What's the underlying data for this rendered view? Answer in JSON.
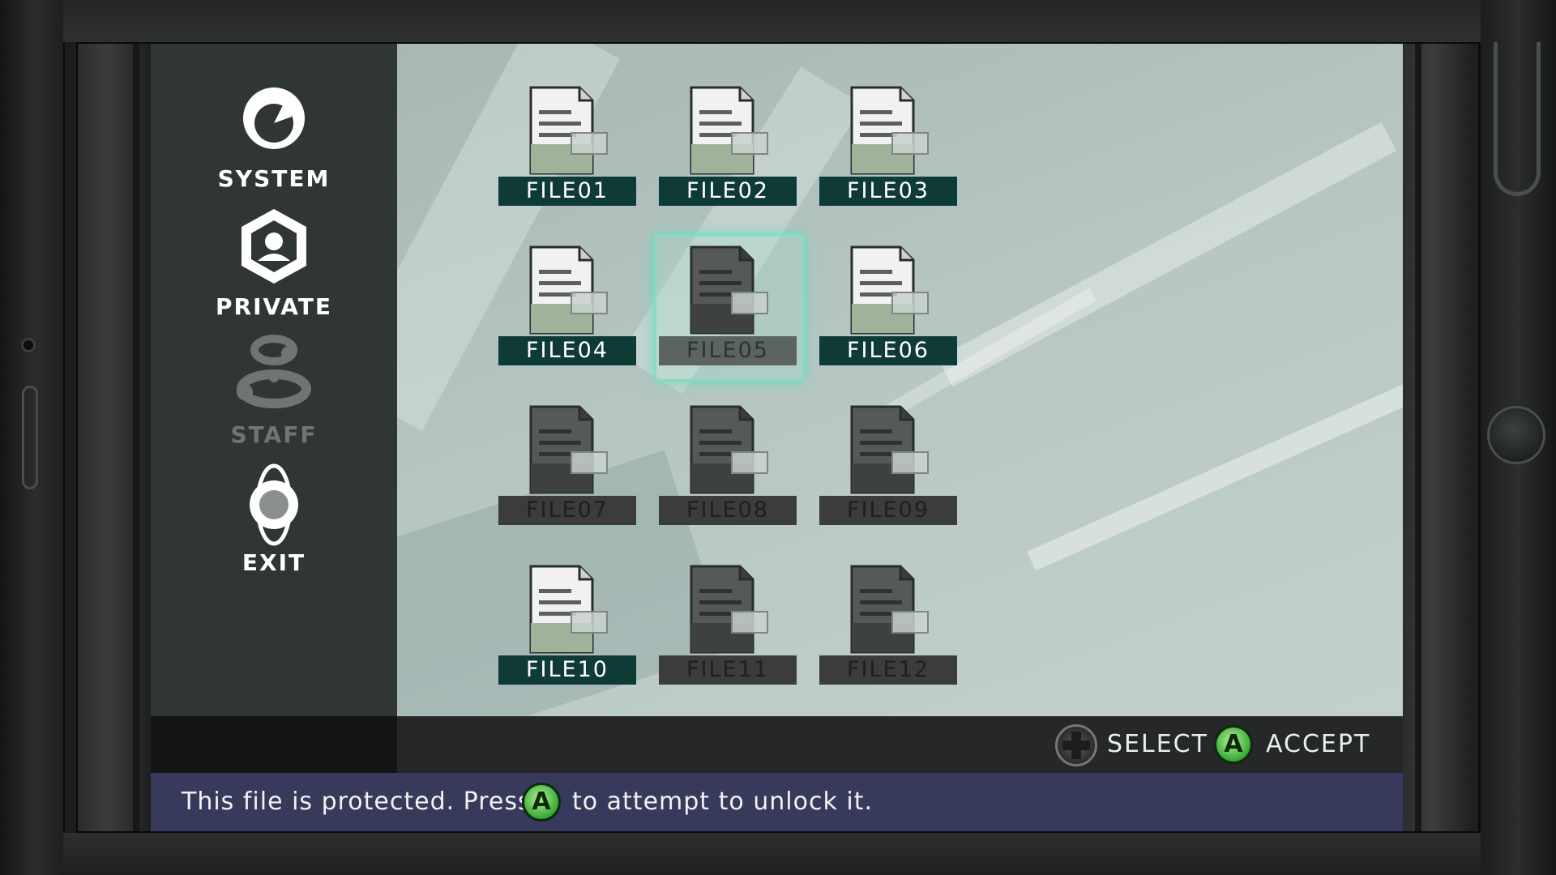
{
  "side_menu": {
    "items": [
      {
        "label": "SYSTEM",
        "icon": "system-icon",
        "enabled": true
      },
      {
        "label": "PRIVATE",
        "icon": "person-icon",
        "enabled": true
      },
      {
        "label": "STAFF",
        "icon": "staff-icon",
        "enabled": false
      },
      {
        "label": "EXIT",
        "icon": "exit-icon",
        "enabled": true
      }
    ]
  },
  "files": [
    {
      "label": "FILE01",
      "locked": false
    },
    {
      "label": "FILE02",
      "locked": false
    },
    {
      "label": "FILE03",
      "locked": false
    },
    {
      "label": "FILE04",
      "locked": false
    },
    {
      "label": "FILE05",
      "locked": true,
      "selected": true
    },
    {
      "label": "FILE06",
      "locked": false
    },
    {
      "label": "FILE07",
      "locked": true
    },
    {
      "label": "FILE08",
      "locked": true
    },
    {
      "label": "FILE09",
      "locked": true
    },
    {
      "label": "FILE10",
      "locked": false
    },
    {
      "label": "FILE11",
      "locked": true
    },
    {
      "label": "FILE12",
      "locked": true
    }
  ],
  "controls": {
    "select_label": "SELECT",
    "accept_button": "A",
    "accept_label": "ACCEPT"
  },
  "message": {
    "before": "This file is protected. Press",
    "button": "A",
    "after": "to attempt to unlock it."
  },
  "colors": {
    "label_bg": "#0f3b37",
    "locked_label_bg": "#3a3c3d",
    "message_bar": "#373a5a",
    "highlight": "#7be0c4",
    "a_button": "#3fae3a"
  }
}
